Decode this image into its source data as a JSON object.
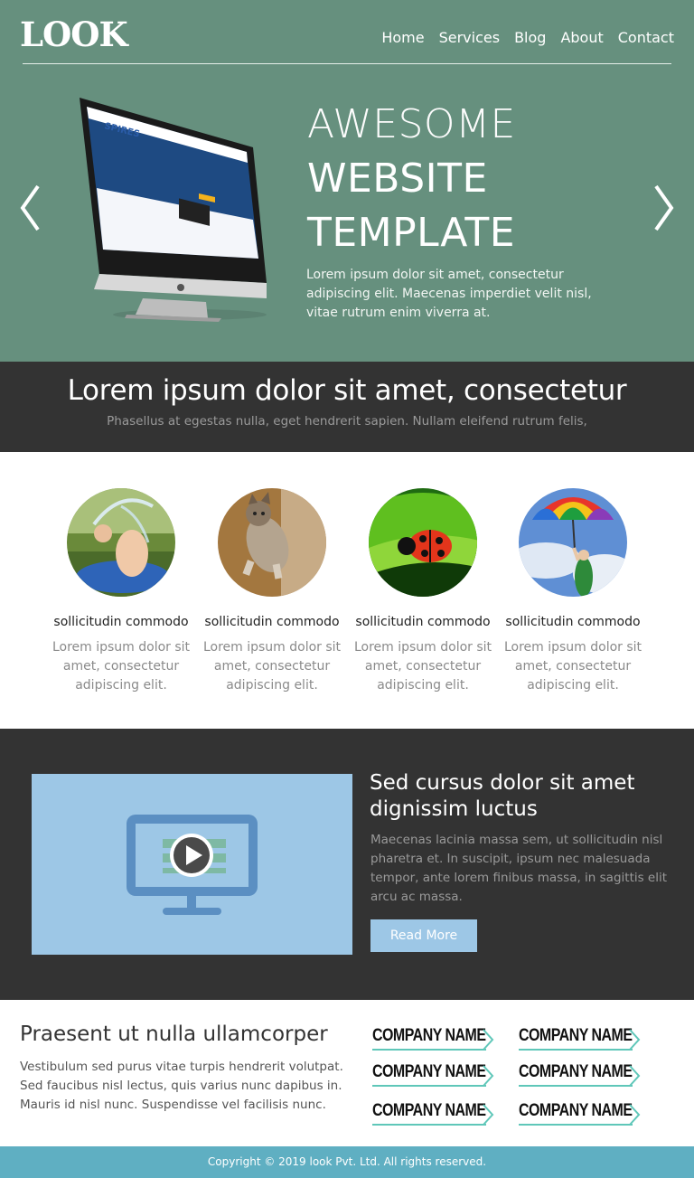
{
  "brand": {
    "logo": "LOOK"
  },
  "nav": {
    "items": [
      "Home",
      "Services",
      "Blog",
      "About",
      "Contact"
    ]
  },
  "hero": {
    "title_line1": "AWESOME",
    "title_line2": "WEBSITE",
    "title_line3": "TEMPLATE",
    "text": "Lorem ipsum dolor sit amet, consectetur adipiscing elit. Maecenas imperdiet velit nisl, vitae rutrum enim viverra at.",
    "prev_icon": "chevron-left-icon",
    "next_icon": "chevron-right-icon",
    "image": "imac-monitor-website-screenshot"
  },
  "band": {
    "heading": "Lorem ipsum dolor sit amet, consectetur",
    "subtext": "Phasellus at egestas nulla, eget hendrerit sapien. Nullam eleifend rutrum felis,"
  },
  "features": [
    {
      "image": "child-splashing-water-photo",
      "title": "sollicitudin commodo",
      "text": "Lorem ipsum dolor sit amet, consectetur adipiscing elit."
    },
    {
      "image": "kitten-jumping-photo",
      "title": "sollicitudin commodo",
      "text": "Lorem ipsum dolor sit amet, consectetur adipiscing elit."
    },
    {
      "image": "ladybug-on-leaf-photo",
      "title": "sollicitudin commodo",
      "text": "Lorem ipsum dolor sit amet, consectetur adipiscing elit."
    },
    {
      "image": "person-with-rainbow-umbrella-photo",
      "title": "sollicitudin commodo",
      "text": "Lorem ipsum dolor sit amet, consectetur adipiscing elit."
    }
  ],
  "video": {
    "icon": "monitor-play-icon",
    "heading": "Sed cursus dolor sit amet dignissim luctus",
    "text": "Maecenas lacinia massa sem, ut sollicitudin nisl pharetra et. In suscipit, ipsum nec malesuada tempor, ante lorem finibus massa, in sagittis elit arcu ac massa.",
    "button": "Read More"
  },
  "bottom": {
    "heading": "Praesent ut nulla ullamcorper",
    "text": "Vestibulum sed purus vitae turpis hendrerit volutpat. Sed faucibus nisl lectus, quis varius nunc dapibus in. Mauris id nisl nunc. Suspendisse vel facilisis nunc.",
    "companies": [
      "COMPANY NAME",
      "COMPANY NAME",
      "COMPANY NAME",
      "COMPANY NAME",
      "COMPANY NAME",
      "COMPANY NAME"
    ]
  },
  "footer": {
    "copyright": "Copyright © 2019 look Pvt. Ltd. All rights reserved."
  },
  "colors": {
    "hero_bg": "#66907e",
    "dark_bg": "#333333",
    "video_bg": "#9dc7e6",
    "accent": "#5fc7b9",
    "footer_bg": "#5fafc2"
  }
}
